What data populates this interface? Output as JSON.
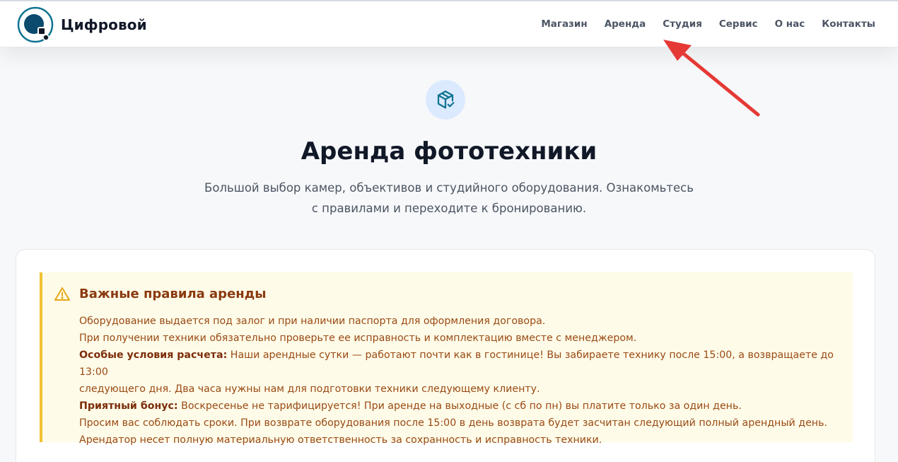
{
  "header": {
    "brand": "Цифровой",
    "nav": [
      "Магазин",
      "Аренда",
      "Студия",
      "Сервис",
      "О нас",
      "Контакты"
    ]
  },
  "hero": {
    "icon": "package-check-icon",
    "title": "Аренда фототехники",
    "subtitle_line1": "Большой выбор камер, объективов и студийного оборудования. Ознакомьтесь",
    "subtitle_line2": "с правилами и переходите к бронированию."
  },
  "rules": {
    "icon": "warning-icon",
    "title": "Важные правила аренды",
    "line1": "Оборудование выдается под залог и при наличии паспорта для оформления договора.",
    "line2": "При получении техники обязательно проверьте ее исправность и комплектацию вместе с менеджером.",
    "special_label": "Особые условия расчета:",
    "special_text_1": " Наши арендные сутки — работают почти как в гостинице! Вы забираете технику после 15:00, а возвращаете до 13:00",
    "special_text_2": "следующего дня. Два часа нужны нам для подготовки техники следующему клиенту.",
    "bonus_label": "Приятный бонус:",
    "bonus_text": " Воскресенье не тарифицируется! При аренде на выходные (с сб по пн) вы платите только за один день.",
    "line3": "Просим вас соблюдать сроки. При возврате оборудования после 15:00 в день возврата будет засчитан следующий полный арендный день.",
    "line4": "Арендатор несет полную материальную ответственность за сохранность и исправность техники."
  },
  "colors": {
    "accent": "#0e7490",
    "warning_border": "#f1c232",
    "warning_bg": "#fefbe8",
    "annotation_arrow": "#e53935"
  }
}
